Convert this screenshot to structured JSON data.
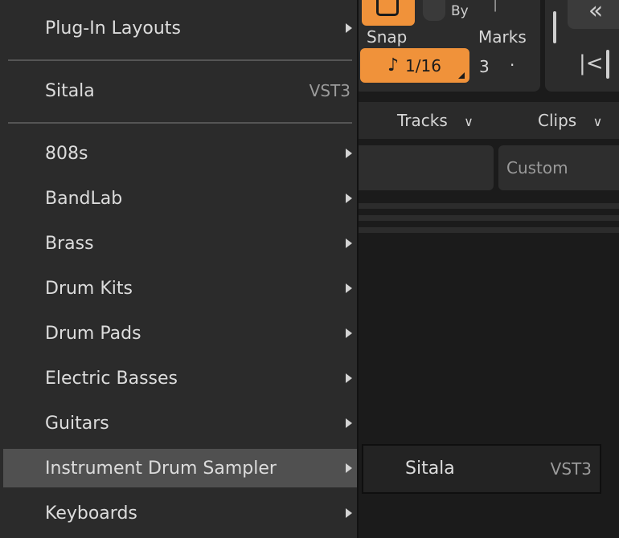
{
  "toolbar": {
    "snap_label": "Snap",
    "by_label": "By",
    "marks_label": "Marks",
    "snap_value": "1/16",
    "marks_value": "3",
    "marks_dot": "·",
    "accent_color": "#f0923a"
  },
  "tabs": {
    "tracks": "Tracks",
    "clips": "Clips"
  },
  "header_cell": {
    "custom": "Custom"
  },
  "menu": {
    "items": [
      {
        "label": "Plug-In Layouts",
        "submenu": true
      },
      {
        "label": "Sitala",
        "tag": "VST3"
      },
      {
        "label": "808s",
        "submenu": true
      },
      {
        "label": "BandLab",
        "submenu": true
      },
      {
        "label": "Brass",
        "submenu": true
      },
      {
        "label": "Drum Kits",
        "submenu": true
      },
      {
        "label": "Drum Pads",
        "submenu": true
      },
      {
        "label": "Electric Basses",
        "submenu": true
      },
      {
        "label": "Guitars",
        "submenu": true
      },
      {
        "label": "Instrument Drum Sampler",
        "submenu": true,
        "highlighted": true
      },
      {
        "label": "Keyboards",
        "submenu": true
      }
    ]
  },
  "submenu": {
    "label": "Sitala",
    "tag": "VST3"
  }
}
